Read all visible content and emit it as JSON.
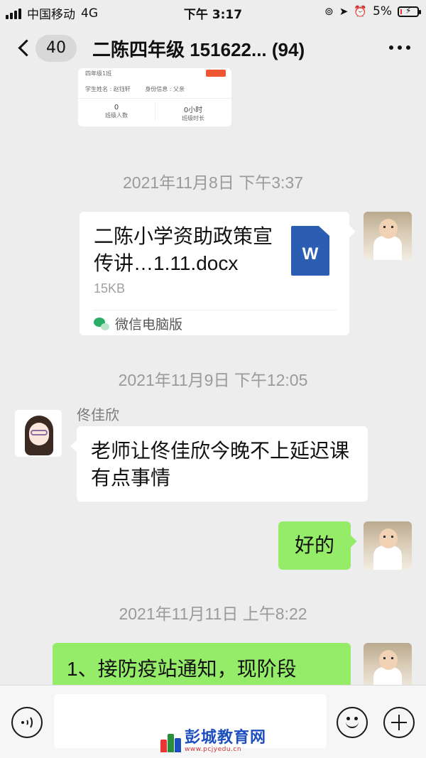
{
  "status_bar": {
    "carrier": "中国移动",
    "network": "4G",
    "time": "下午 3:17",
    "battery": "5%"
  },
  "nav": {
    "unread_count": "40",
    "title": "二陈四年级 151622... (94)"
  },
  "card": {
    "class_name": "四年级1班",
    "student_name": "学生姓名 : 赵钰轩",
    "identity": "身份信息 : 父亲",
    "stats": [
      {
        "value": "0",
        "label": "班级人数"
      },
      {
        "value": "0小时",
        "label": "班级时长"
      }
    ]
  },
  "messages": {
    "ts1": "2021年11月8日 下午3:37",
    "file": {
      "name": "二陈小学资助政策宣传讲…1.11.docx",
      "size": "15KB",
      "icon_letter": "W",
      "source": "微信电脑版"
    },
    "ts2": "2021年11月9日 下午12:05",
    "sender": "佟佳欣",
    "incoming_text": "老师让佟佳欣今晚不上延迟课有点事情",
    "reply_text": "好的",
    "ts3": "2021年11月11日 上午8:22",
    "last_text": "1、接防疫站通知，现阶段"
  },
  "watermark": {
    "title": "彭城教育网",
    "url": "www.pcjyedu.cn"
  },
  "colors": {
    "background": "#ededed",
    "outgoing_bubble": "#95ec69",
    "incoming_bubble": "#ffffff",
    "word_icon": "#2b5eb3"
  },
  "icons": [
    "back-chevron-icon",
    "more-dots-icon",
    "voice-icon",
    "emoji-icon",
    "plus-icon",
    "wechat-pc-icon",
    "word-file-icon"
  ]
}
